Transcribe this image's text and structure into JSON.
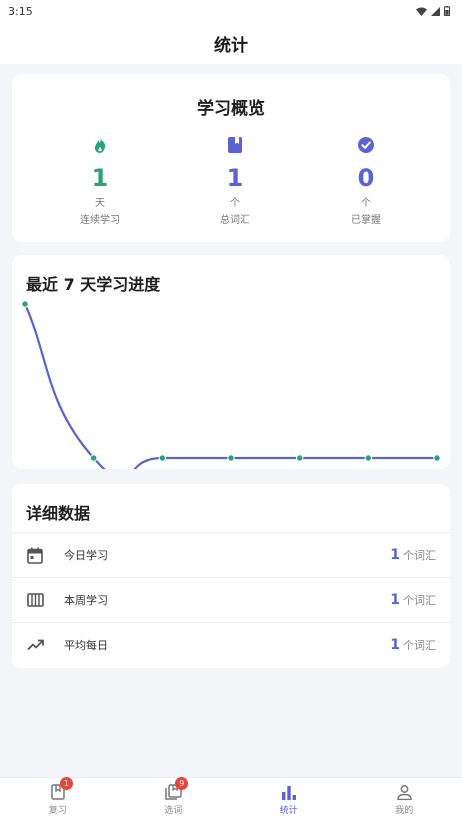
{
  "status_bar": {
    "time": "3:15"
  },
  "header": {
    "title": "统计"
  },
  "overview": {
    "title": "学习概览",
    "stats": [
      {
        "icon": "fire-icon",
        "value": "1",
        "unit": "天",
        "label": "连续学习",
        "color": "#2aa37a"
      },
      {
        "icon": "book-icon",
        "value": "1",
        "unit": "个",
        "label": "总词汇",
        "color": "#5b63d4"
      },
      {
        "icon": "check-circle-icon",
        "value": "0",
        "unit": "个",
        "label": "已掌握",
        "color": "#5b63d4"
      }
    ]
  },
  "progress": {
    "title": "最近 7 天学习进度"
  },
  "chart_data": {
    "type": "line",
    "title": "最近 7 天学习进度",
    "x": [
      1,
      2,
      3,
      4,
      5,
      6,
      7
    ],
    "series": [
      {
        "values": [
          1,
          0,
          0,
          0,
          0,
          0,
          0
        ]
      }
    ],
    "ylim": [
      0,
      1
    ],
    "grid": false,
    "color": "#5b63d4",
    "point_color": "#2aa37a"
  },
  "details": {
    "title": "详细数据",
    "rows": [
      {
        "icon": "calendar-icon",
        "label": "今日学习",
        "value": "1",
        "unit": "个词汇"
      },
      {
        "icon": "week-icon",
        "label": "本周学习",
        "value": "1",
        "unit": "个词汇"
      },
      {
        "icon": "trending-up-icon",
        "label": "平均每日",
        "value": "1",
        "unit": "个词汇"
      }
    ]
  },
  "nav": {
    "items": [
      {
        "label": "复习",
        "icon": "review-icon",
        "badge": "1",
        "active": false
      },
      {
        "label": "选词",
        "icon": "select-words-icon",
        "badge": "9",
        "active": false
      },
      {
        "label": "统计",
        "icon": "stats-icon",
        "badge": "",
        "active": true
      },
      {
        "label": "我的",
        "icon": "profile-icon",
        "badge": "",
        "active": false
      }
    ]
  }
}
